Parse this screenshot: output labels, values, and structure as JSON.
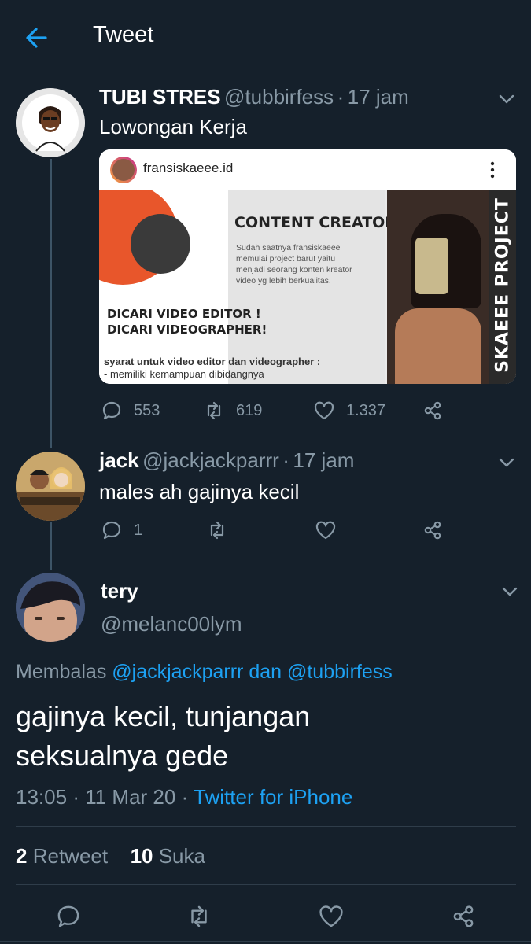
{
  "header": {
    "title": "Tweet"
  },
  "tweet1": {
    "name": "TUBI STRES",
    "handle": "@tubbirfess",
    "time": "17 jam",
    "text": "Lowongan Kerja",
    "card": {
      "username": "fransiskaeee.id",
      "title": "CONTENT CREATOR",
      "desc1": "Sudah saatnya fransiskaeee",
      "desc2": "memulai project baru! yaitu",
      "desc3": "menjadi seorang konten kreator",
      "desc4": "video yg lebih berkualitas.",
      "cta1": "DICARI VIDEO EDITOR !",
      "cta2": "DICARI VIDEOGRAPHER!",
      "req": "syarat untuk video editor dan videographer :",
      "req2": "- memiliki kemampuan dibidangnya",
      "side_text": "SKAEEE PROJECT"
    },
    "replies": "553",
    "retweets": "619",
    "likes": "1.337"
  },
  "tweet2": {
    "name": "jack",
    "handle": "@jackjackparrr",
    "time": "17 jam",
    "text": "males ah gajinya kecil",
    "replies": "1"
  },
  "main": {
    "name": "tery",
    "handle": "@melanc00lym",
    "reply_prefix": "Membalas",
    "reply_user1": "@jackjackparrr",
    "reply_and": "dan",
    "reply_user2": "@tubbirfess",
    "text_line1": "gajinya kecil, tunjangan",
    "text_line2": "seksualnya gede",
    "time": "13:05",
    "date": "11 Mar 20",
    "source": "Twitter for iPhone",
    "retweet_count": "2",
    "retweet_label": "Retweet",
    "like_count": "10",
    "like_label": "Suka"
  },
  "colors": {
    "background": "#15202b",
    "accent": "#1da1f2",
    "muted": "#8899a6",
    "divider": "#2f3d4a"
  },
  "icons": [
    "back-arrow-icon",
    "chevron-down-icon",
    "reply-icon",
    "retweet-icon",
    "like-icon",
    "share-icon",
    "more-vertical-icon"
  ]
}
